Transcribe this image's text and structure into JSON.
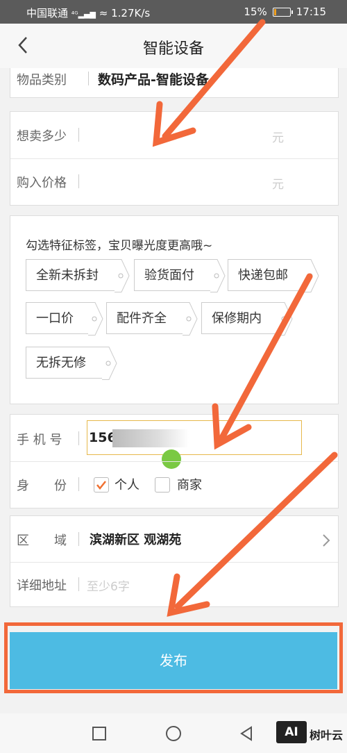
{
  "status_bar": {
    "carrier": "中国联通",
    "speed": "1.27K/s",
    "battery": "15%",
    "battery_level": 0.15,
    "time": "17:15"
  },
  "header": {
    "title": "智能设备"
  },
  "category": {
    "label": "物品类别",
    "value": "数码产品-智能设备"
  },
  "price": {
    "sell_label": "想卖多少",
    "sell_unit": "元",
    "buy_label": "购入价格",
    "buy_unit": "元"
  },
  "tags": {
    "hint": "勾选特征标签，宝贝曝光度更高哦~",
    "items": [
      "全新未拆封",
      "验货面付",
      "快递包邮",
      "一口价",
      "配件齐全",
      "保修期内",
      "无拆无修"
    ]
  },
  "contact": {
    "phone_label": "手 机 号",
    "phone_value": "156",
    "identity_label": "身　　份",
    "identity_options": [
      "个人",
      "商家"
    ],
    "identity_selected": "个人"
  },
  "address": {
    "region_label": "区　　域",
    "region_value": "滨湖新区 观湖苑",
    "detail_label": "详细地址",
    "detail_placeholder": "至少6字"
  },
  "publish_button": {
    "label": "发布"
  },
  "watermark": {
    "text": "树叶云",
    "badge": "AI"
  },
  "colors": {
    "accent": "#4dbbe3",
    "annotation": "#f2683a",
    "check": "#f07030",
    "input_border": "#e6b84a"
  }
}
